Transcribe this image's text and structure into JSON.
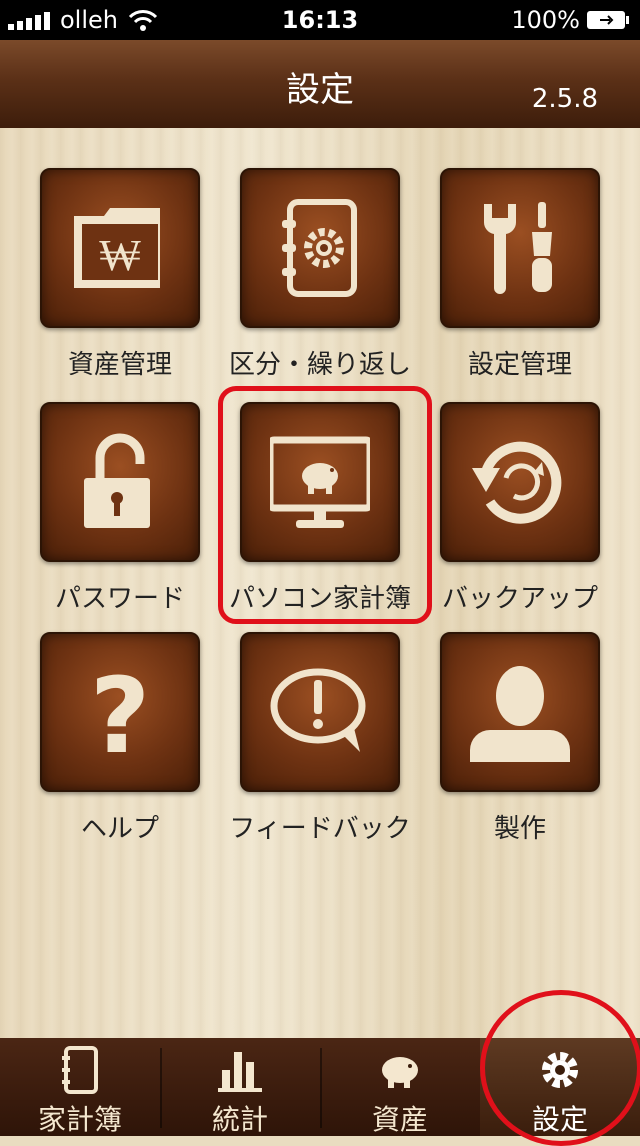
{
  "status_bar": {
    "carrier": "olleh",
    "time": "16:13",
    "battery": "100%"
  },
  "nav": {
    "title": "設定",
    "version": "2.5.8"
  },
  "grid": [
    {
      "label": "資産管理",
      "icon": "wallet-won-icon"
    },
    {
      "label": "区分・繰り返し",
      "icon": "notebook-gear-icon"
    },
    {
      "label": "設定管理",
      "icon": "tools-icon"
    },
    {
      "label": "パスワード",
      "icon": "unlocked-padlock-icon"
    },
    {
      "label": "パソコン家計簿",
      "icon": "monitor-piggy-icon"
    },
    {
      "label": "バックアップ",
      "icon": "sync-arrows-icon"
    },
    {
      "label": "ヘルプ",
      "icon": "question-mark-icon"
    },
    {
      "label": "フィードバック",
      "icon": "speech-bubble-exclamation-icon"
    },
    {
      "label": "製作",
      "icon": "person-silhouette-icon"
    }
  ],
  "tabs": [
    {
      "label": "家計簿",
      "icon": "notebook-icon"
    },
    {
      "label": "統計",
      "icon": "bar-chart-icon"
    },
    {
      "label": "資産",
      "icon": "piggy-bank-icon"
    },
    {
      "label": "設定",
      "icon": "gear-icon",
      "active": true
    }
  ],
  "colors": {
    "highlight": "#e0101a",
    "icon_fill": "#f1e4cc",
    "tile_brown": "#6e3212"
  }
}
